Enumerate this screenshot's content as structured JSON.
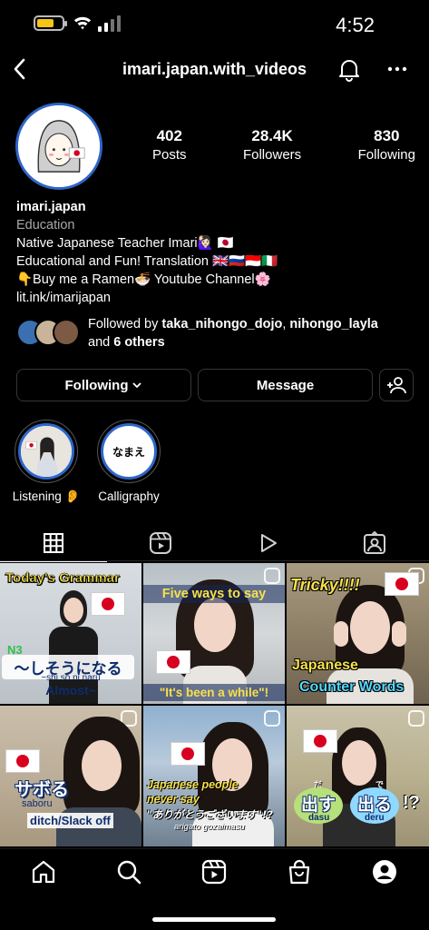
{
  "status_bar": {
    "time": "4:52"
  },
  "header": {
    "username": "imari.japan.with_videos"
  },
  "profile": {
    "stats": [
      {
        "value": "402",
        "label": "Posts"
      },
      {
        "value": "28.4K",
        "label": "Followers"
      },
      {
        "value": "830",
        "label": "Following"
      }
    ],
    "name": "imari.japan",
    "category": "Education",
    "bio_lines": [
      "Native Japanese Teacher Imari🙋🏻‍♀️ 🇯🇵",
      "Educational and Fun! Translation 🇬🇧🇷🇺🇮🇩🇮🇹",
      "👇Buy me a Ramen🍜 Youtube Channel🌸"
    ],
    "link": "lit.ink/imarijapan",
    "followed_by": {
      "prefix": "Followed by ",
      "user1": "taka_nihongo_dojo",
      "sep": ", ",
      "user2": "nihongo_layla",
      "and": " and ",
      "others": "6 others"
    }
  },
  "actions": {
    "following_label": "Following",
    "message_label": "Message"
  },
  "highlights": [
    {
      "label": "Listening 👂"
    },
    {
      "label": "Calligraphy",
      "cover_text": "なまえ"
    }
  ],
  "grid": {
    "posts": [
      {
        "line1": "Today's Grammar",
        "tag": "N3",
        "line2": "〜しそうになる",
        "line3": "~shi sō ni naru",
        "line4": "Almost~"
      },
      {
        "line1": "Five ways to say",
        "line2": "\"It's been a while\"!"
      },
      {
        "line1": "Tricky!!!!",
        "line2": "Japanese",
        "line3": "Counter Words"
      },
      {
        "line1": "サボる",
        "line2": "saboru",
        "line3": "ditch/Slack off"
      },
      {
        "line1": "Japanese people",
        "line2": "never say",
        "line3": "\"ありがとうございます\"!?",
        "line4": "arigato gozaimasu"
      },
      {
        "ruby1": "だ",
        "word1": "出す",
        "read1": "dasu",
        "ruby2": "で",
        "word2": "出る",
        "read2": "deru",
        "suffix": "!?"
      }
    ]
  },
  "colors": {
    "avatar_ring": "#2e66c9",
    "background": "#000000",
    "border": "#363636",
    "secondary_text": "#a8a8a8"
  }
}
